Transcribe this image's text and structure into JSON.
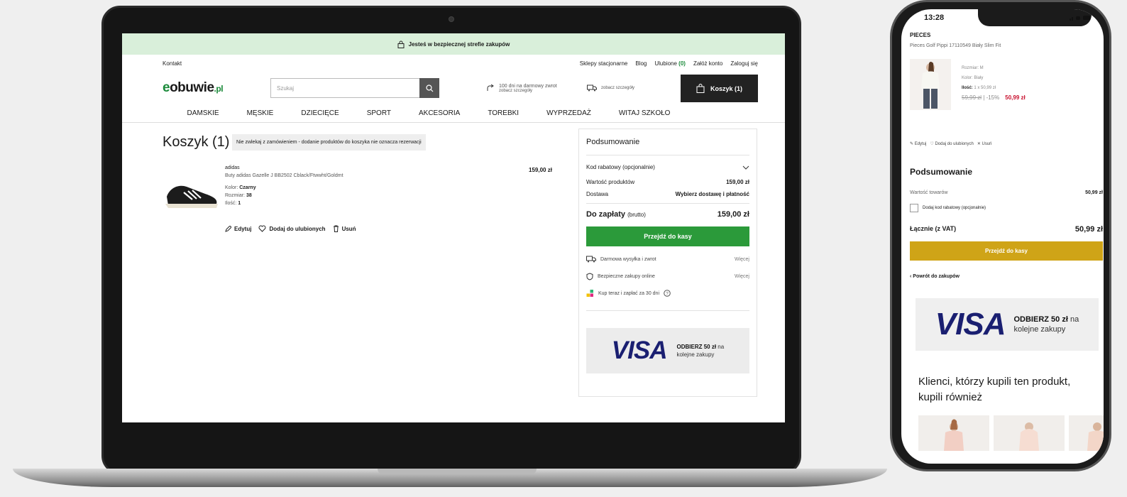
{
  "desktop": {
    "security_bar": "Jesteś w bezpiecznej strefie zakupów",
    "util": {
      "contact": "Kontakt",
      "links": [
        "Sklepy stacjonarne",
        "Blog"
      ],
      "favorites_label": "Ulubione",
      "favorites_count": "(0)",
      "register": "Załóż konto",
      "login": "Zaloguj się"
    },
    "header": {
      "logo_e": "e",
      "logo_main": "obuwie",
      "logo_tld": ".pl",
      "search_placeholder": "Szukaj",
      "returns_line1": "100 dni na darmowy zwrot",
      "returns_line2": "zobacz szczegóły",
      "delivery_text": "zobacz szczegóły",
      "cart_label": "Koszyk (1)"
    },
    "nav": [
      "DAMSKIE",
      "MĘSKIE",
      "DZIECIĘCE",
      "SPORT",
      "AKCESORIA",
      "TOREBKI",
      "WYPRZEDAŻ",
      "WITAJ SZKOŁO"
    ],
    "cart_title": "Koszyk (1)",
    "notice": "Nie zwlekaj z zamówieniem - dodanie produktów do koszyka nie oznacza rezerwacji",
    "product": {
      "brand": "adidas",
      "description": "Buty adidas Gazelle J BB2502 Cblack/Ftwwht/Goldmt",
      "color_label": "Kolor:",
      "color": "Czarny",
      "size_label": "Rozmiar:",
      "size": "38",
      "qty_label": "Ilość:",
      "qty": "1",
      "price": "159,00 zł",
      "edit": "Edytuj",
      "favorite": "Dodaj do ulubionych",
      "remove": "Usuń"
    },
    "summary": {
      "title": "Podsumowanie",
      "discount": "Kod rabatowy (opcjonalnie)",
      "products_label": "Wartość produktów",
      "products_value": "159,00 zł",
      "delivery_label": "Dostawa",
      "delivery_value": "Wybierz dostawę i płatność",
      "total_label": "Do zapłaty",
      "total_suffix": "(brutto)",
      "total_value": "159,00 zł",
      "checkout": "Przejdź do kasy",
      "perks": [
        {
          "text": "Darmowa wysyłka i zwrot",
          "more": "Więcej"
        },
        {
          "text": "Bezpieczne zakupy online",
          "more": "Więcej"
        },
        {
          "text": "Kup teraz i zapłać za 30 dni",
          "more": ""
        }
      ],
      "visa_logo": "VISA",
      "visa_bold": "ODBIERZ 50 zł",
      "visa_rest1": "na",
      "visa_rest2": "kolejne zakupy"
    }
  },
  "mobile": {
    "time": "13:28",
    "brand": "PIECES",
    "name": "Pieces Golf Pippi 17110549 Biały Slim Fit",
    "size": "Rozmiar: M",
    "color": "Kolor: Biały",
    "qty_label": "Ilość:",
    "qty": "1 x 50,99 zł",
    "old_price": "59,99 zł",
    "discount": "| -15%",
    "price": "50,99 zł",
    "edit": "Edytuj",
    "favorite": "Dodaj do ulubionych",
    "remove": "Usuń",
    "summary_title": "Podsumowanie",
    "goods_label": "Wartość towarów",
    "goods_value": "50,99 zł",
    "discount_checkbox": "Dodaj kod rabatowy (opcjonalnie)",
    "total_label": "Łącznie (z VAT)",
    "total_value": "50,99 zł",
    "checkout": "Przejdź do kasy",
    "back": "Powrót do zakupów",
    "visa_logo": "VISA",
    "visa_bold": "ODBIERZ 50 zł",
    "visa_rest1": "na",
    "visa_rest2": "kolejne zakupy",
    "recommend": "Klienci, którzy kupili ten produkt, kupili również"
  },
  "colors": {
    "brand_green": "#1b8a3a",
    "checkout_green": "#2b9a3a",
    "mobile_checkout": "#cfa417",
    "sale_red": "#c8102e",
    "visa_blue": "#1a1f71"
  }
}
